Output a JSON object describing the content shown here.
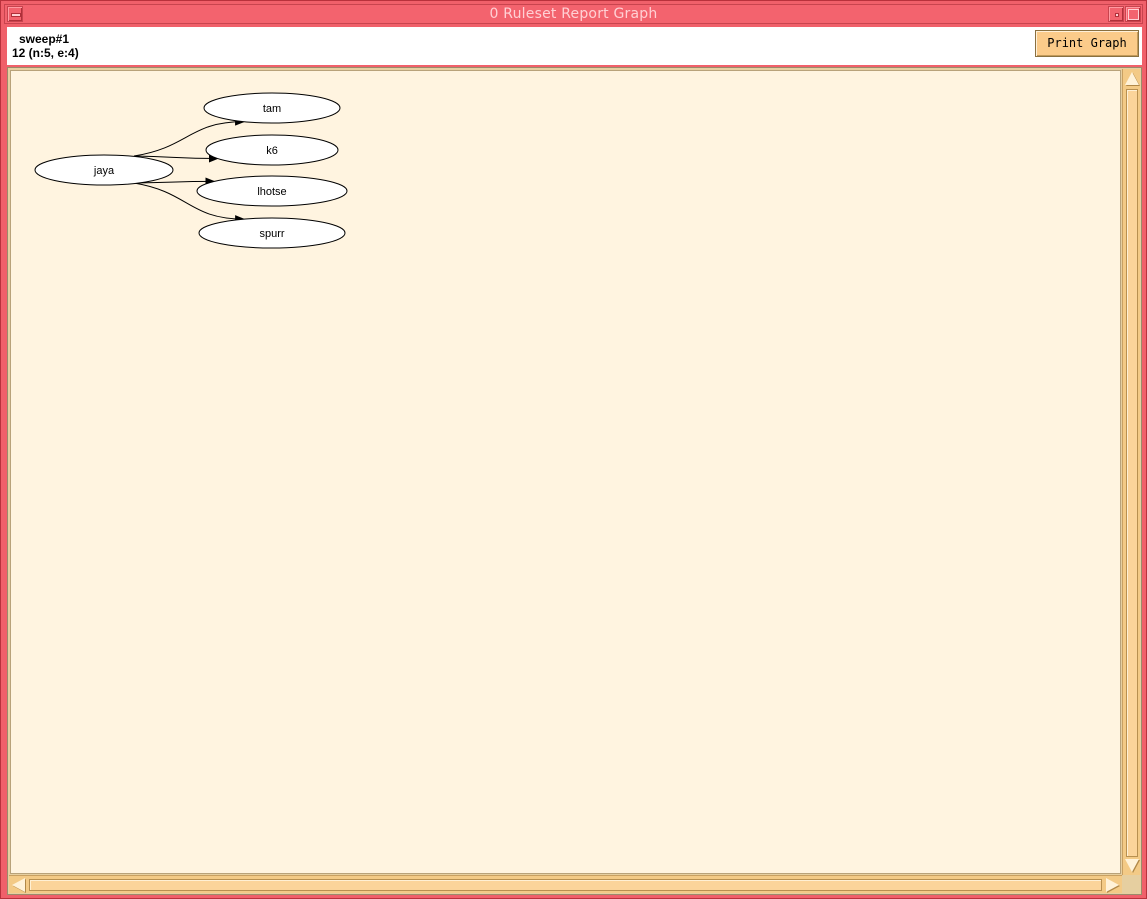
{
  "window": {
    "title": "0 Ruleset Report Graph"
  },
  "header": {
    "name": "sweep#1",
    "summary": "12 (n:5, e:4)",
    "print_label": "Print Graph"
  },
  "graph": {
    "nodes": [
      {
        "id": "jaya",
        "label": "jaya"
      },
      {
        "id": "tam",
        "label": "tam"
      },
      {
        "id": "k6",
        "label": "k6"
      },
      {
        "id": "lhotse",
        "label": "lhotse"
      },
      {
        "id": "spurr",
        "label": "spurr"
      }
    ],
    "edges": [
      {
        "from": "jaya",
        "to": "tam"
      },
      {
        "from": "jaya",
        "to": "k6"
      },
      {
        "from": "jaya",
        "to": "lhotse"
      },
      {
        "from": "jaya",
        "to": "spurr"
      }
    ]
  },
  "colors": {
    "frame": "#f0606a",
    "canvas": "#fff4e0",
    "button": "#fbcb8a",
    "scrollbar": "#f3ca86"
  }
}
